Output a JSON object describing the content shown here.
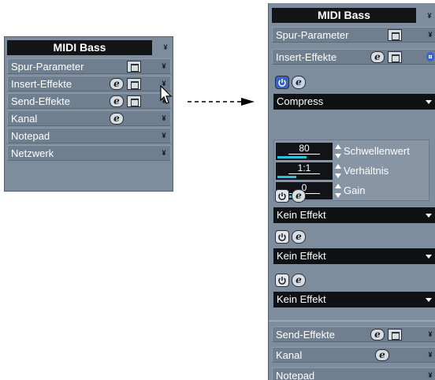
{
  "left_panel": {
    "title": "MIDI Bass",
    "sections": [
      {
        "label": "Spur-Parameter",
        "has_edit": false,
        "has_box": true
      },
      {
        "label": "Insert-Effekte",
        "has_edit": true,
        "has_box": true
      },
      {
        "label": "Send-Effekte",
        "has_edit": true,
        "has_box": true
      },
      {
        "label": "Kanal",
        "has_edit": true,
        "has_box": false
      },
      {
        "label": "Notepad",
        "has_edit": false,
        "has_box": false
      },
      {
        "label": "Netzwerk",
        "has_edit": false,
        "has_box": false
      }
    ]
  },
  "right_panel": {
    "title": "MIDI Bass",
    "top_sections": [
      {
        "label": "Spur-Parameter"
      },
      {
        "label": "Insert-Effekte"
      }
    ],
    "inserts": [
      {
        "effect": "Compress",
        "params": [
          {
            "value": "80",
            "label": "Schwellenwert",
            "level": 0.55
          },
          {
            "value": "1:1",
            "label": "Verhältnis",
            "level": 0.35
          },
          {
            "value": "0",
            "label": "Gain",
            "level": 0.5
          }
        ]
      },
      {
        "effect": "Kein Effekt"
      },
      {
        "effect": "Kein Effekt"
      },
      {
        "effect": "Kein Effekt"
      }
    ],
    "bottom_sections": [
      {
        "label": "Send-Effekte"
      },
      {
        "label": "Kanal"
      },
      {
        "label": "Notepad"
      }
    ]
  },
  "icons": {
    "edit": "e",
    "expand_arrow": "¥",
    "collapse_arrow": "¤"
  }
}
